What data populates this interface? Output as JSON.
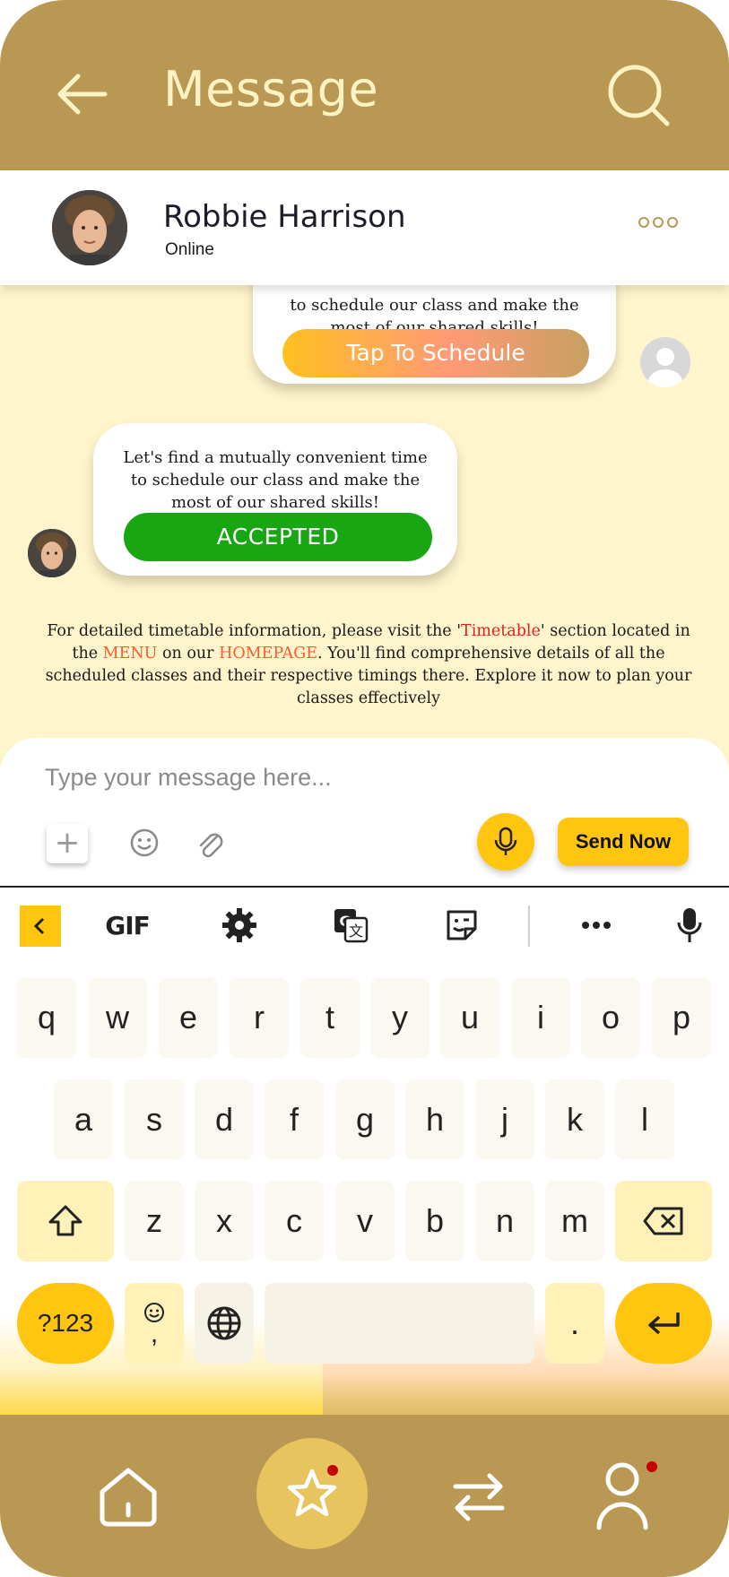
{
  "header": {
    "title": "Message",
    "back_icon": "arrow-left-icon",
    "search_icon": "search-icon"
  },
  "contact": {
    "name": "Robbie Harrison",
    "status": "Online",
    "more_icon": "more-dots-icon"
  },
  "messages": {
    "outgoing_text": "to schedule our class and make the most of our shared skills!",
    "outgoing_button": "Tap To Schedule",
    "incoming_text": "Let's find a mutually convenient time to schedule our class and make the most of our shared skills!",
    "incoming_status": "ACCEPTED"
  },
  "info": {
    "part1": "For detailed timetable information, please visit the '",
    "timetable": "Timetable",
    "part2": "' section located in the ",
    "menu": "MENU",
    "part3": " on our ",
    "homepage": "HOMEPAGE",
    "part4": ". You'll find comprehensive details of all the scheduled classes and their respective timings there. Explore it now to plan your classes effectively"
  },
  "composer": {
    "placeholder": "Type your message here...",
    "plus": "+",
    "send_label": "Send Now"
  },
  "keyboard": {
    "toolbar": {
      "gif": "GIF"
    },
    "row1": [
      "q",
      "w",
      "e",
      "r",
      "t",
      "y",
      "u",
      "i",
      "o",
      "p"
    ],
    "row2": [
      "a",
      "s",
      "d",
      "f",
      "g",
      "h",
      "j",
      "k",
      "l"
    ],
    "row3": [
      "z",
      "x",
      "c",
      "v",
      "b",
      "n",
      "m"
    ],
    "symbols": "?123",
    "comma": ",",
    "period": "."
  },
  "colors": {
    "brand": "#b99853",
    "accent": "#ffc50f",
    "accepted": "#18a712",
    "background": "#fff5cc"
  }
}
